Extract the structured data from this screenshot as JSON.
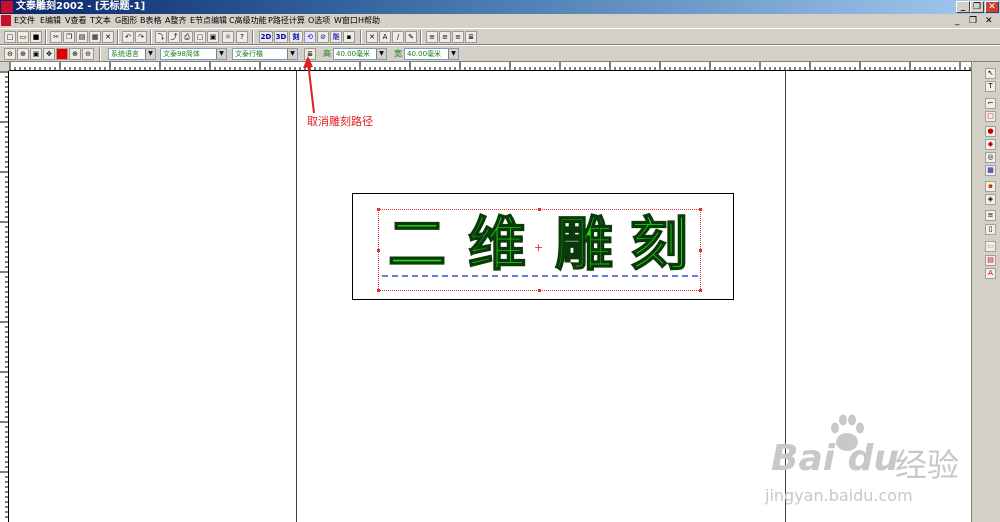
{
  "window": {
    "title": "文泰雕刻2002 - [无标题-1]",
    "controls": [
      "_",
      "❐",
      "✕"
    ],
    "mdi_controls": [
      "_",
      "❐",
      "✕"
    ]
  },
  "menu": [
    "E文件",
    "E编辑",
    "V查看",
    "T文本",
    "G图形",
    "B表格",
    "A整齐",
    "E节点编辑",
    "C高级功能",
    "P路径计算",
    "O选项",
    "W窗口",
    "H帮助"
  ],
  "toolbar2": {
    "text_buttons": [
      "2D",
      "3D",
      "刻"
    ],
    "fonts": {
      "language": "系统语言",
      "font": "文泰98简体",
      "style": "文泰行楷"
    },
    "height_label": "高",
    "height_value": "40.00毫米",
    "width_label": "宽",
    "width_value": "40.00毫米"
  },
  "canvas": {
    "engraving_text": [
      "二",
      "维",
      "雕",
      "刻"
    ],
    "center_mark": "+"
  },
  "annotation": {
    "text": "取消雕刻路径",
    "color": "#e02020"
  },
  "watermark": {
    "logo": "Bai du",
    "cn": "经验",
    "url": "jingyan.baidu.com"
  },
  "colors": {
    "title_bar": "#0a246a",
    "engrave_fill": "#22e010",
    "selection": "#e03030",
    "baseline": "#6a7ad8"
  }
}
